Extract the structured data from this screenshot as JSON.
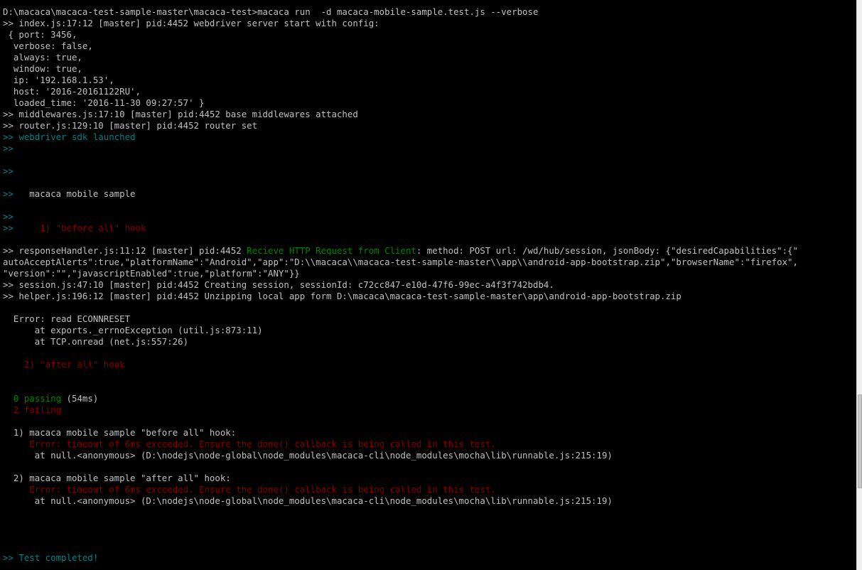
{
  "colors": {
    "background": "#000000",
    "default": "#c0c0c0",
    "cyan": "#008080",
    "green": "#008000",
    "red": "#800000"
  },
  "terminal": {
    "lines": [
      [
        {
          "t": "D:\\macaca\\macaca-test-sample-master\\macaca-test>macaca run  -d macaca-mobile-sample.test.js --verbose",
          "c": "default"
        }
      ],
      [
        {
          "t": ">> index.js:17:12 [master] pid:4452 webdriver server start with config:",
          "c": "default"
        }
      ],
      [
        {
          "t": " { port: 3456,",
          "c": "default"
        }
      ],
      [
        {
          "t": "  verbose: false,",
          "c": "default"
        }
      ],
      [
        {
          "t": "  always: true,",
          "c": "default"
        }
      ],
      [
        {
          "t": "  window: true,",
          "c": "default"
        }
      ],
      [
        {
          "t": "  ip: '192.168.1.53',",
          "c": "default"
        }
      ],
      [
        {
          "t": "  host: '2016-20161122RU',",
          "c": "default"
        }
      ],
      [
        {
          "t": "  loaded_time: '2016-11-30 09:27:57' }",
          "c": "default"
        }
      ],
      [
        {
          "t": ">> middlewares.js:17:10 [master] pid:4452 base middlewares attached",
          "c": "default"
        }
      ],
      [
        {
          "t": ">> router.js:129:10 [master] pid:4452 router set",
          "c": "default"
        }
      ],
      [
        {
          "t": ">> webdriver sdk launched",
          "c": "cyan"
        }
      ],
      [
        {
          "t": ">>",
          "c": "cyan"
        }
      ],
      [
        {
          "t": "",
          "c": "default"
        }
      ],
      [
        {
          "t": ">>",
          "c": "cyan"
        }
      ],
      [
        {
          "t": "",
          "c": "default"
        }
      ],
      [
        {
          "t": ">>",
          "c": "cyan"
        },
        {
          "t": "   macaca mobile sample",
          "c": "default"
        }
      ],
      [
        {
          "t": "",
          "c": "default"
        }
      ],
      [
        {
          "t": ">>",
          "c": "cyan"
        }
      ],
      [
        {
          "t": ">>",
          "c": "cyan"
        },
        {
          "t": "     1) \"before all\" hook",
          "c": "red"
        }
      ],
      [
        {
          "t": "",
          "c": "default"
        }
      ],
      [
        {
          "t": ">> responseHandler.js:11:12 [master] pid:4452 ",
          "c": "default"
        },
        {
          "t": "Recieve HTTP Request from Client",
          "c": "green"
        },
        {
          "t": ": method: POST url: /wd/hub/session, jsonBody: {\"desiredCapabilities\":{\"",
          "c": "default"
        }
      ],
      [
        {
          "t": "autoAcceptAlerts\":true,\"platformName\":\"Android\",\"app\":\"D:\\\\macaca\\\\macaca-test-sample-master\\\\app\\\\android-app-bootstrap.zip\",\"browserName\":\"firefox\",",
          "c": "default"
        }
      ],
      [
        {
          "t": "\"version\":\"\",\"javascriptEnabled\":true,\"platform\":\"ANY\"}}",
          "c": "default"
        }
      ],
      [
        {
          "t": ">> session.js:47:10 [master] pid:4452 Creating session, sessionId: c72cc847-e10d-47f6-99ec-a4f3f742bdb4.",
          "c": "default"
        }
      ],
      [
        {
          "t": ">> helper.js:196:12 [master] pid:4452 Unzipping local app form D:\\macaca\\macaca-test-sample-master\\app\\android-app-bootstrap.zip",
          "c": "default"
        }
      ],
      [
        {
          "t": "",
          "c": "default"
        }
      ],
      [
        {
          "t": "  Error: read ECONNRESET",
          "c": "default"
        }
      ],
      [
        {
          "t": "      at exports._errnoException (util.js:873:11)",
          "c": "default"
        }
      ],
      [
        {
          "t": "      at TCP.onread (net.js:557:26)",
          "c": "default"
        }
      ],
      [
        {
          "t": "",
          "c": "default"
        }
      ],
      [
        {
          "t": "    2) \"after all\" hook",
          "c": "red"
        }
      ],
      [
        {
          "t": "",
          "c": "default"
        }
      ],
      [
        {
          "t": "",
          "c": "default"
        }
      ],
      [
        {
          "t": "  0 passing",
          "c": "green"
        },
        {
          "t": " (54ms)",
          "c": "default"
        }
      ],
      [
        {
          "t": "  2 failing",
          "c": "red"
        }
      ],
      [
        {
          "t": "",
          "c": "default"
        }
      ],
      [
        {
          "t": "  1) macaca mobile sample \"before all\" hook:",
          "c": "default"
        }
      ],
      [
        {
          "t": "     Error: timeout of 6ms exceeded. Ensure the done() callback is being called in this test.",
          "c": "red"
        }
      ],
      [
        {
          "t": "      at null.<anonymous> (D:\\nodejs\\node-global\\node_modules\\macaca-cli\\node_modules\\mocha\\lib\\runnable.js:215:19)",
          "c": "default"
        }
      ],
      [
        {
          "t": "",
          "c": "default"
        }
      ],
      [
        {
          "t": "  2) macaca mobile sample \"after all\" hook:",
          "c": "default"
        }
      ],
      [
        {
          "t": "     Error: timeout of 6ms exceeded. Ensure the done() callback is being called in this test.",
          "c": "red"
        }
      ],
      [
        {
          "t": "      at null.<anonymous> (D:\\nodejs\\node-global\\node_modules\\macaca-cli\\node_modules\\mocha\\lib\\runnable.js:215:19)",
          "c": "default"
        }
      ],
      [
        {
          "t": "",
          "c": "default"
        }
      ],
      [
        {
          "t": "",
          "c": "default"
        }
      ],
      [
        {
          "t": "",
          "c": "default"
        }
      ],
      [
        {
          "t": "",
          "c": "default"
        }
      ],
      [
        {
          "t": ">> Test completed!",
          "c": "cyan"
        }
      ]
    ]
  }
}
